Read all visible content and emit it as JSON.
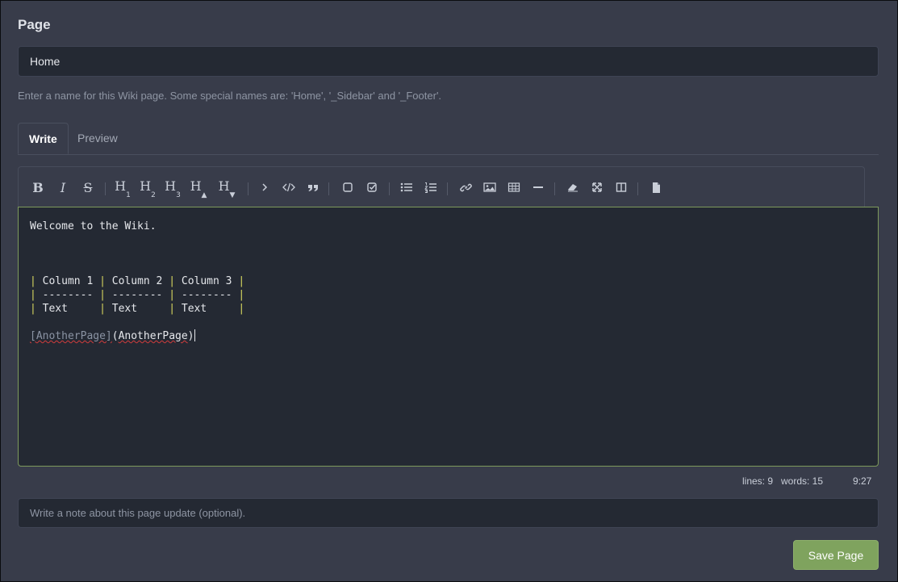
{
  "page_label": "Page",
  "name_input": {
    "value": "Home"
  },
  "help_text": "Enter a name for this Wiki page. Some special names are: 'Home', '_Sidebar' and '_Footer'.",
  "tabs": [
    {
      "label": "Write",
      "active": true
    },
    {
      "label": "Preview",
      "active": false
    }
  ],
  "toolbar": {
    "bold": "B",
    "italic": "I",
    "strikethrough": "S",
    "headings": [
      {
        "letter": "H",
        "sub": "1"
      },
      {
        "letter": "H",
        "sub": "2"
      },
      {
        "letter": "H",
        "sub": "3"
      },
      {
        "letter": "H",
        "sub": "▲"
      },
      {
        "letter": "H",
        "sub": "▼"
      }
    ],
    "icons": [
      "chevron-right-icon",
      "code-icon",
      "quote-icon",
      "checkbox-icon",
      "checked-box-icon",
      "unordered-list-icon",
      "ordered-list-icon",
      "link-icon",
      "image-icon",
      "table-icon",
      "horizontal-rule-icon",
      "eraser-icon",
      "fullscreen-icon",
      "side-by-side-icon",
      "document-icon"
    ]
  },
  "editor": {
    "lines": [
      "Welcome to the Wiki.",
      "",
      "",
      "",
      "",
      "",
      ""
    ],
    "welcome": "Welcome to the Wiki.",
    "table": {
      "row1": [
        " Column 1 ",
        " Column 2 ",
        " Column 3 "
      ],
      "row2": [
        " -------- ",
        " -------- ",
        " -------- "
      ],
      "row3": [
        " Text     ",
        " Text     ",
        " Text     "
      ]
    },
    "link_text": "[AnotherPage]",
    "link_url_open": "(",
    "link_url": "AnotherPage",
    "link_url_close": ")"
  },
  "status": {
    "lines": "lines: 9",
    "words": "words: 15",
    "cursor": "9:27"
  },
  "note_input": {
    "placeholder": "Write a note about this page update (optional)."
  },
  "save_button": "Save Page",
  "colors": {
    "background": "#383c4a",
    "input_bg": "#242933",
    "accent_green": "#7fa35e",
    "editor_border": "#7d9a5c"
  }
}
